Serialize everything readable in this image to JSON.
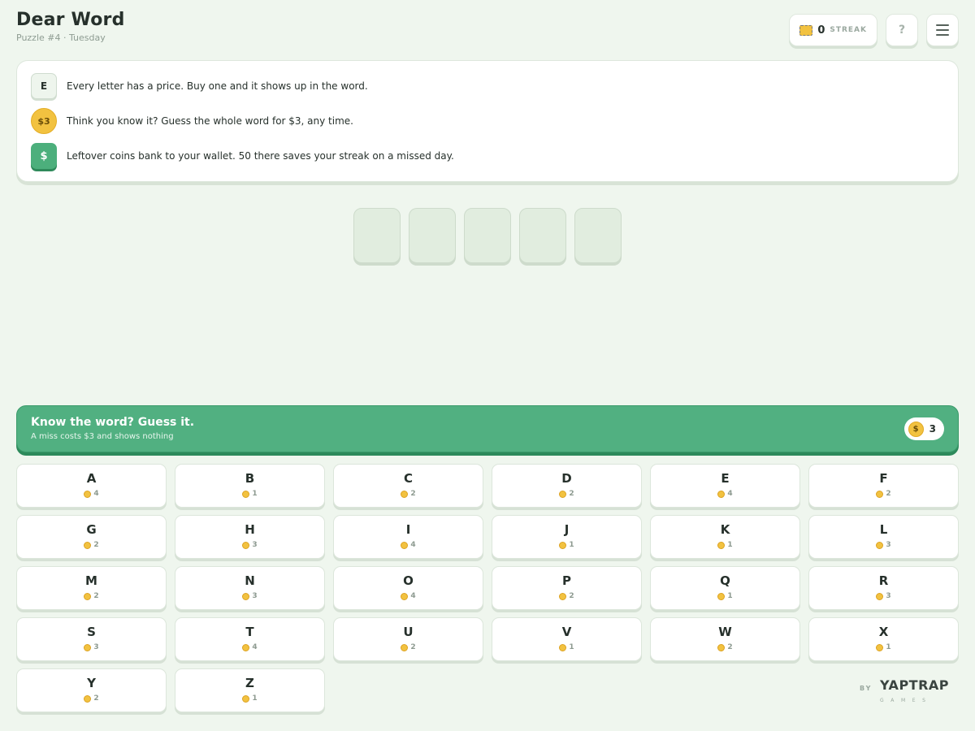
{
  "header": {
    "title": "Dear Word",
    "subtitle": "Puzzle #4 · Tuesday",
    "streak_count": "0",
    "streak_label": "STREAK",
    "help_label": "?"
  },
  "rules": [
    {
      "badge": "E",
      "text": "Every letter has a price. Buy one and it shows up in the word."
    },
    {
      "badge": "$3",
      "text": "Think you know it? Guess the whole word for $3, any time."
    },
    {
      "badge": "$",
      "text": "Leftover coins bank to your wallet. 50 there saves your streak on a missed day."
    }
  ],
  "word": {
    "length": 5
  },
  "guess_bar": {
    "title": "Know the word? Guess it.",
    "subtitle": "A miss costs $3 and shows nothing",
    "coin_symbol": "$",
    "wallet": "3"
  },
  "keys": [
    {
      "letter": "A",
      "cost": "4"
    },
    {
      "letter": "B",
      "cost": "1"
    },
    {
      "letter": "C",
      "cost": "2"
    },
    {
      "letter": "D",
      "cost": "2"
    },
    {
      "letter": "E",
      "cost": "4"
    },
    {
      "letter": "F",
      "cost": "2"
    },
    {
      "letter": "G",
      "cost": "2"
    },
    {
      "letter": "H",
      "cost": "3"
    },
    {
      "letter": "I",
      "cost": "4"
    },
    {
      "letter": "J",
      "cost": "1"
    },
    {
      "letter": "K",
      "cost": "1"
    },
    {
      "letter": "L",
      "cost": "3"
    },
    {
      "letter": "M",
      "cost": "2"
    },
    {
      "letter": "N",
      "cost": "3"
    },
    {
      "letter": "O",
      "cost": "4"
    },
    {
      "letter": "P",
      "cost": "2"
    },
    {
      "letter": "Q",
      "cost": "1"
    },
    {
      "letter": "R",
      "cost": "3"
    },
    {
      "letter": "S",
      "cost": "3"
    },
    {
      "letter": "T",
      "cost": "4"
    },
    {
      "letter": "U",
      "cost": "2"
    },
    {
      "letter": "V",
      "cost": "1"
    },
    {
      "letter": "W",
      "cost": "2"
    },
    {
      "letter": "X",
      "cost": "1"
    },
    {
      "letter": "Y",
      "cost": "2"
    },
    {
      "letter": "Z",
      "cost": "1"
    }
  ],
  "brand": {
    "by": "BY",
    "name": "YAPTRAP",
    "sub": "GAMES"
  },
  "colors": {
    "accent": "#51b081",
    "coin": "#f2c240",
    "background": "#eff6ee"
  }
}
